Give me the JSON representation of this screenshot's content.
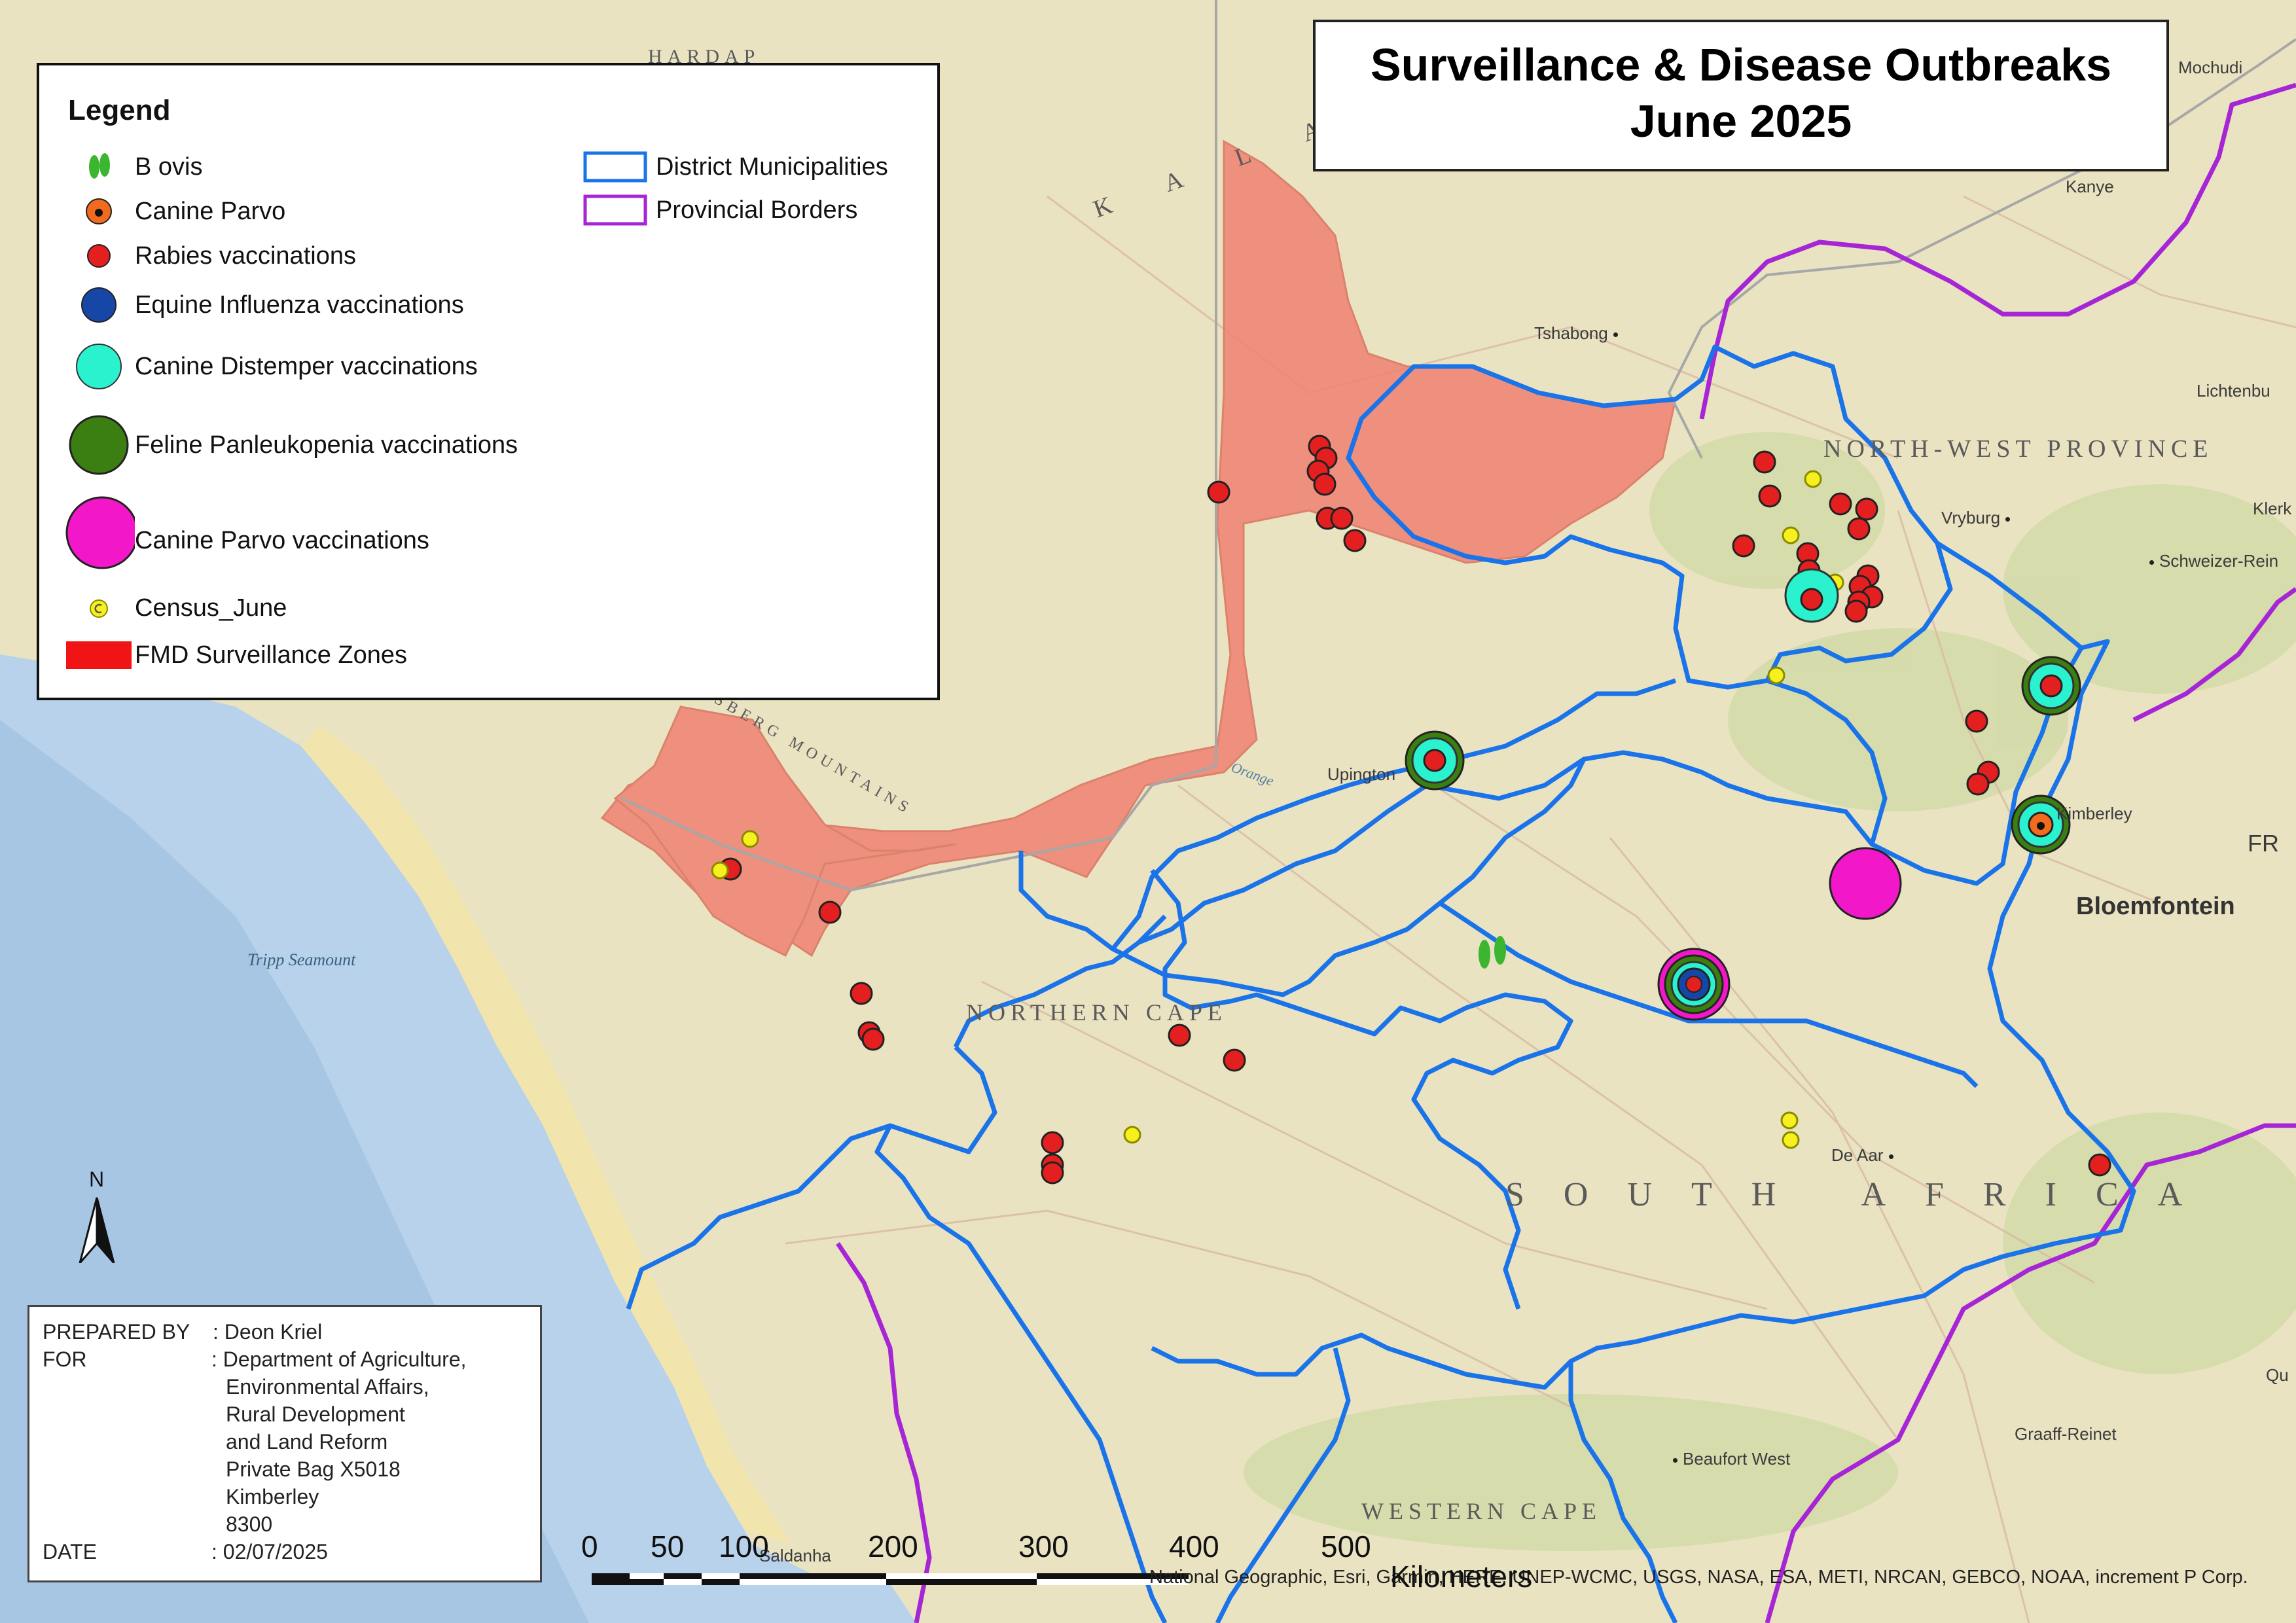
{
  "title": {
    "line1": "Surveillance & Disease Outbreaks",
    "line2": "June 2025"
  },
  "legend": {
    "heading": "Legend",
    "items": [
      {
        "label": "B ovis",
        "symbol": "hoof-icon",
        "color": "#3cb531"
      },
      {
        "label": "Canine Parvo",
        "symbol": "orange-drop-circle",
        "color": "#f26b1d"
      },
      {
        "label": "Rabies vaccinations",
        "symbol": "red-circle",
        "color": "#e41f1f"
      },
      {
        "label": "Equine Influenza vaccinations",
        "symbol": "blue-circle",
        "color": "#1747a6"
      },
      {
        "label": "Canine Distemper vaccinations",
        "symbol": "cyan-circle",
        "color": "#2af2cf"
      },
      {
        "label": "Feline Panleukopenia vaccinations",
        "symbol": "green-circle",
        "color": "#3b7f12"
      },
      {
        "label": "Canine Parvo vaccinations",
        "symbol": "magenta-circle",
        "color": "#f217c9"
      },
      {
        "label": "Census_June",
        "symbol": "census-c-icon",
        "color": "#f6f01e"
      },
      {
        "label": "FMD Surveillance Zones",
        "symbol": "red-rect",
        "color": "#f01414"
      }
    ],
    "boundaries": [
      {
        "label": "District Municipalities",
        "color": "#1a73e8"
      },
      {
        "label": "Provincial Borders",
        "color": "#a626d6"
      }
    ]
  },
  "prepared": {
    "by_key": "PREPARED BY",
    "by_val": ": Deon Kriel",
    "for_key": "FOR",
    "for_lines": [
      ": Department of Agriculture,",
      "Environmental Affairs,",
      "Rural Development",
      "and  Land Reform",
      "Private Bag X5018",
      "Kimberley",
      "8300"
    ],
    "date_key": "DATE",
    "date_val": ": 02/07/2025"
  },
  "scale": {
    "ticks": [
      "0",
      "50",
      "100",
      "200",
      "300",
      "400",
      "500"
    ],
    "units": "Kilometers"
  },
  "attribution": "National Geographic, Esri, Garmin, HERE, UNEP-WCMC, USGS, NASA, ESA, METI, NRCAN, GEBCO, NOAA, increment P Corp.",
  "north_label": "N",
  "places": [
    "Tshabong",
    "Upington",
    "Vryburg",
    "Schweizer-Rein",
    "Kimberley",
    "Bloemfontein",
    "De Aar",
    "Beaufort West",
    "Graaff-Reinet",
    "Lichtenbu",
    "Klerk",
    "Mochudi",
    "Kanye",
    "Saldanha",
    "Qu",
    "FR"
  ],
  "regions": [
    "NORTH-WEST PROVINCE",
    "NORTHERN CAPE",
    "SOUTH AFRICA",
    "WESTERN CAPE",
    "K A L A",
    "SBERG MOUNTAINS",
    "HARDAP"
  ],
  "water": [
    "Tripp Seamount",
    "Orange"
  ],
  "colors": {
    "ocean": "#b7d2ea",
    "land": "#e9e3c2",
    "fmd": "#f08272",
    "district": "#1a73e8",
    "province": "#a626d6"
  }
}
